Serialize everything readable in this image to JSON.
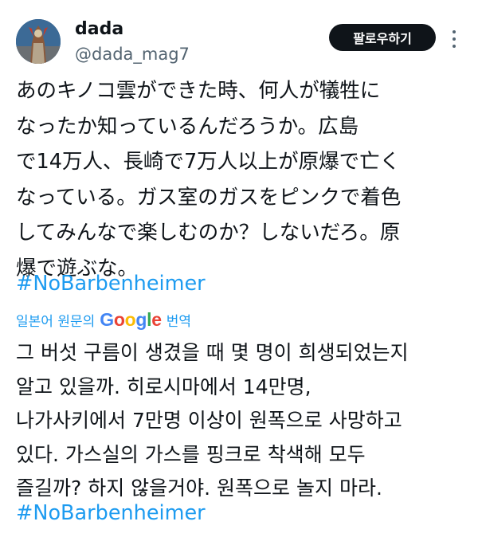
{
  "author": {
    "display_name": "dada",
    "handle": "@dada_mag7"
  },
  "follow_label": "팔로우하기",
  "tweet": {
    "text": "あのキノコ雲ができた時、何人が犠牲に\nなったか知っているんだろうか。広島\nで14万人、長崎で7万人以上が原爆で亡く\nなっている。ガス室のガスをピンクで着色\nしてみんなで楽しむのか？しないだろ。原\n爆で遊ぶな。",
    "hashtag": "#NoBarbenheimer"
  },
  "translation": {
    "prefix": "일본어 원문의",
    "google_letters": [
      "G",
      "o",
      "o",
      "g",
      "l",
      "e"
    ],
    "google_colors": [
      "#4285F4",
      "#EA4335",
      "#FBBC05",
      "#4285F4",
      "#34A853",
      "#EA4335"
    ],
    "suffix": "번역",
    "text": "그 버섯 구름이 생겼을 때 몇 명이 희생되었는지\n알고 있을까. 히로시마에서 14만명,\n나가사키에서 7만명 이상이 원폭으로 사망하고\n있다. 가스실의 가스를 핑크로 착색해 모두\n즐길까? 하지 않을거야. 원폭으로 놀지 마라.",
    "hashtag": "#NoBarbenheimer"
  },
  "colors": {
    "link": "#1d9bf0",
    "text": "#0f1419",
    "muted": "#536471"
  },
  "icons": {
    "more": "more-vertical-icon"
  }
}
